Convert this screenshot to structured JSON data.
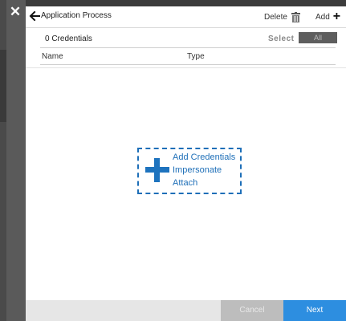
{
  "window": {
    "close_label": "✕"
  },
  "header": {
    "title": "Application Process",
    "delete_label": "Delete",
    "add_label": "Add",
    "add_icon": "+"
  },
  "subheader": {
    "count_label": "0 Credentials",
    "select_label": "Select",
    "all_label": "All"
  },
  "columns": {
    "name": "Name",
    "type": "Type"
  },
  "add_zone": {
    "links": [
      "Add Credentials",
      "Impersonate",
      "Attach"
    ]
  },
  "footer": {
    "cancel_label": "Cancel",
    "next_label": "Next"
  },
  "colors": {
    "accent": "#1e6fb8",
    "next_button": "#2d8ee0",
    "cancel_button": "#bdbdbd"
  }
}
